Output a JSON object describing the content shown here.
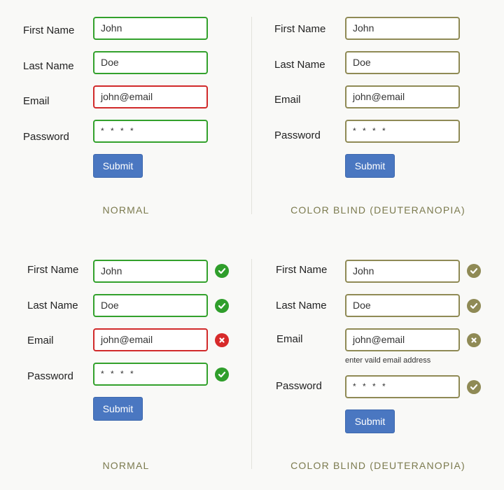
{
  "labels": {
    "first_name": "First Name",
    "last_name": "Last Name",
    "email": "Email",
    "password": "Password"
  },
  "values": {
    "first_name": "John",
    "last_name": "Doe",
    "email": "john@email",
    "password": "* * * *"
  },
  "submit_label": "Submit",
  "captions": {
    "normal": "NORMAL",
    "color_blind": "COLOR BLIND (DEUTERANOPIA)"
  },
  "hint": "enter vaild email address",
  "colors": {
    "valid": "#33a12c",
    "invalid": "#d12a2a",
    "color_blind_border": "#8f8a55",
    "button": "#4a77c1",
    "caption": "#7b7a4e"
  },
  "icons": {
    "valid": "check-icon",
    "invalid": "x-icon"
  }
}
